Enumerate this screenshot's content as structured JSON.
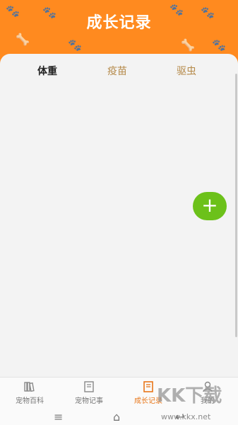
{
  "header": {
    "title": "成长记录"
  },
  "tabs": [
    {
      "label": "体重",
      "active": true
    },
    {
      "label": "疫苗",
      "active": false
    },
    {
      "label": "驱虫",
      "active": false
    }
  ],
  "fab": {
    "icon": "plus-icon",
    "label": "+"
  },
  "bottom_nav": [
    {
      "label": "宠物百科",
      "icon": "books-icon",
      "active": false
    },
    {
      "label": "宠物记事",
      "icon": "notebook-icon",
      "active": false
    },
    {
      "label": "成长记录",
      "icon": "growth-record-icon",
      "active": true
    },
    {
      "label": "我的",
      "icon": "user-icon",
      "active": false
    }
  ],
  "system_nav": {
    "menu": "≡",
    "home": "⌂",
    "back": "↩"
  },
  "watermark": {
    "text": "KK下载",
    "url": "www.kkx.net"
  },
  "colors": {
    "header": "#ff8a1f",
    "fab": "#6cc11a",
    "active_nav": "#e87619",
    "inactive_tab": "#b58a4a"
  }
}
